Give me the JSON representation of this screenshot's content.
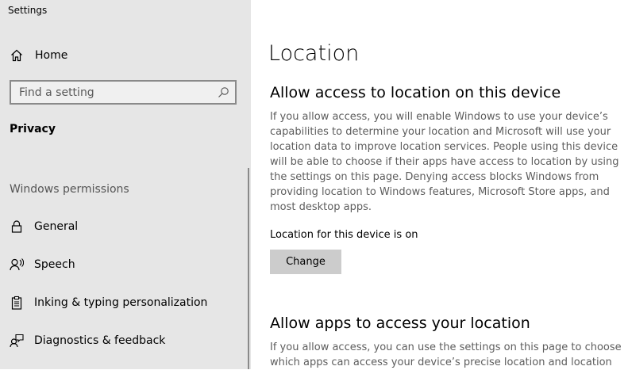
{
  "window": {
    "title": "Settings"
  },
  "sidebar": {
    "home": {
      "label": "Home",
      "icon": "home-icon"
    },
    "search": {
      "placeholder": "Find a setting",
      "value": "",
      "icon": "search-icon"
    },
    "section_label": "Privacy",
    "group_heading": "Windows permissions",
    "items": [
      {
        "label": "General",
        "icon": "lock-icon"
      },
      {
        "label": "Speech",
        "icon": "speech-icon"
      },
      {
        "label": "Inking & typing personalization",
        "icon": "clipboard-icon"
      },
      {
        "label": "Diagnostics & feedback",
        "icon": "feedback-icon"
      }
    ]
  },
  "main": {
    "page_title": "Location",
    "section1": {
      "title": "Allow access to location on this device",
      "description": "If you allow access, you will enable Windows to use your device’s capabilities to determine your location and Microsoft will use your location data to improve location services. People using this device will be able to choose if their apps have access to location by using the settings on this page. Denying access blocks Windows from providing location to Windows features, Microsoft Store apps, and most desktop apps.",
      "status": "Location for this device is on",
      "button_label": "Change"
    },
    "section2": {
      "title": "Allow apps to access your location",
      "description": "If you allow access, you can use the settings on this page to choose which apps can access your device’s precise location and location"
    }
  },
  "colors": {
    "sidebar_bg": "#e6e6e6",
    "button_bg": "#cccccc",
    "description_text": "#5d5d5d"
  }
}
